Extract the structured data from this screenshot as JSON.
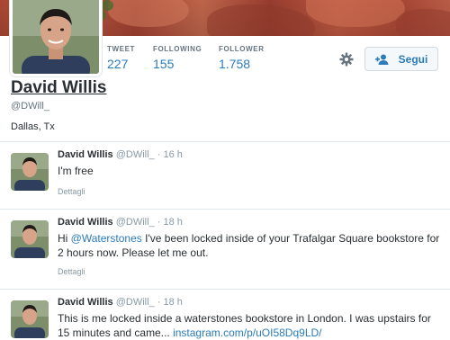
{
  "profile": {
    "name": "David Willis",
    "handle": "@DWill_",
    "location": "Dallas, Tx",
    "follow_label": "Segui"
  },
  "stats": {
    "tweets": {
      "label": "TWEET",
      "value": "227"
    },
    "following": {
      "label": "FOLLOWING",
      "value": "155"
    },
    "followers": {
      "label": "FOLLOWER",
      "value": "1.758"
    }
  },
  "icons": {
    "settings": "gear-icon",
    "follow": "add-user-icon"
  },
  "colors": {
    "accent": "#2b7bb9",
    "muted": "#66757f",
    "banner": "#b24a36"
  },
  "tweets": [
    {
      "name": "David Willis",
      "handle": "@DWill_",
      "dot": "·",
      "time": "16 h",
      "text": "I'm free",
      "details": "Dettagli"
    },
    {
      "name": "David Willis",
      "handle": "@DWill_",
      "dot": "·",
      "time": "18 h",
      "text_prefix": "Hi ",
      "mention": "@Waterstones",
      "text_suffix": " I've been locked inside of your Trafalgar Square bookstore for 2 hours now.  Please let me out.",
      "details": "Dettagli"
    },
    {
      "name": "David Willis",
      "handle": "@DWill_",
      "dot": "·",
      "time": "18 h",
      "text_prefix": "This is me locked inside a waterstones bookstore in London.  I was upstairs for 15 minutes and came... ",
      "link": "instagram.com/p/uOI58Dq9LD/"
    }
  ]
}
